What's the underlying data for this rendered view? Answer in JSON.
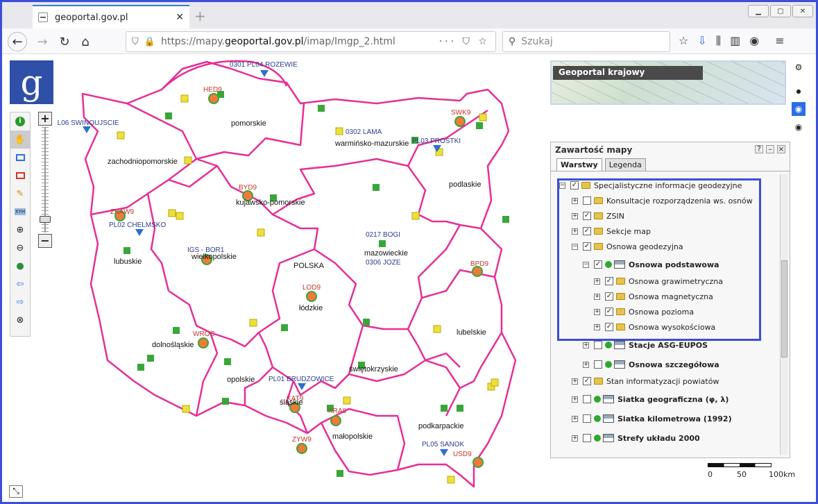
{
  "browser": {
    "tab_title": "geoportal.gov.pl",
    "url_prefix": "https://mapy.",
    "url_domain": "geoportal.gov.pl",
    "url_path": "/imap/Imgp_2.html",
    "search_placeholder": "Szukaj"
  },
  "overview": {
    "title": "Geoportal krajowy"
  },
  "panel": {
    "title": "Zawartość mapy",
    "tabs": [
      "Warstwy",
      "Legenda"
    ],
    "tree": [
      {
        "label": "Specjalistyczne informacje geodezyjne",
        "checked": true,
        "bold": false
      },
      {
        "label": "Konsultacje rozporządzenia ws. osnów",
        "checked": false,
        "bold": false
      },
      {
        "label": "ZSIN",
        "checked": true,
        "bold": false
      },
      {
        "label": "Sekcje map",
        "checked": true,
        "bold": false
      },
      {
        "label": "Osnowa geodezyjna",
        "checked": true,
        "bold": false
      },
      {
        "label": "Osnowa podstawowa",
        "checked": true,
        "bold": true
      },
      {
        "label": "Osnowa grawimetryczna",
        "checked": true,
        "bold": false
      },
      {
        "label": "Osnowa magnetyczna",
        "checked": true,
        "bold": false
      },
      {
        "label": "Osnowa pozioma",
        "checked": true,
        "bold": false
      },
      {
        "label": "Osnowa wysokościowa",
        "checked": true,
        "bold": false
      },
      {
        "label": "Stacje ASG-EUPOS",
        "checked": false,
        "bold": true
      },
      {
        "label": "Osnowa szczegółowa",
        "checked": false,
        "bold": true
      },
      {
        "label": "Stan informatyzacji powiatów",
        "checked": true,
        "bold": false
      },
      {
        "label": "Siatka geograficzna (φ, λ)",
        "checked": false,
        "bold": true
      },
      {
        "label": "Siatka kilometrowa (1992)",
        "checked": false,
        "bold": true
      },
      {
        "label": "Strefy układu 2000",
        "checked": false,
        "bold": true
      }
    ]
  },
  "map": {
    "regions": [
      "pomorskie",
      "zachodniopomorskie",
      "warmińsko-mazurskie",
      "podlaskie",
      "kujawsko-pomorskie",
      "mazowieckie",
      "lubuskie",
      "wielkopolskie",
      "POLSKA",
      "łódzkie",
      "lubelskie",
      "dolnośląskie",
      "opolskie",
      "świętokrzyskie",
      "śląskie",
      "małopolskie",
      "podkarpackie"
    ],
    "stations": [
      "0301 PL04 ROZEWIE",
      "PL06 SWINOUJSCIE",
      "0302 LAMA",
      "PL03 PROSTKI",
      "PL02 CHELMSKO",
      "0217 BOGI",
      "0306 JOZE",
      "IGS - BOR1",
      "PL01 BRUDZOWICE",
      "PL05 SANOK"
    ],
    "red_labels": [
      "HED9",
      "SWK9",
      "BYD9",
      "LOD9",
      "ZKAW9",
      "WROC",
      "KAT9",
      "KRA8",
      "ZYW9",
      "USD9",
      "BPD9"
    ]
  },
  "scale": {
    "labels": [
      "0",
      "50",
      "100km"
    ]
  },
  "colors": {
    "border": "#e62e96",
    "accent": "#3b4fd8"
  }
}
